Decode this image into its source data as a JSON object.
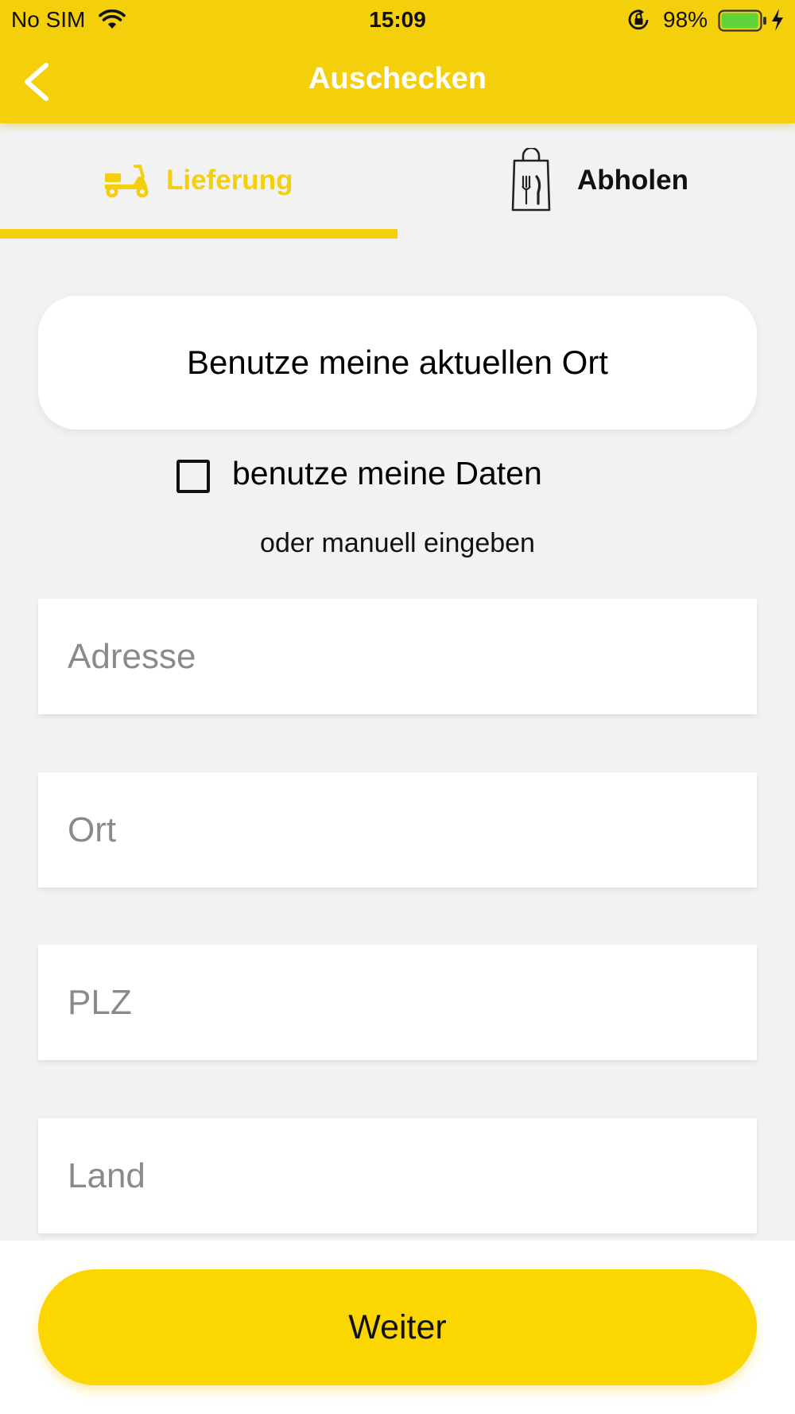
{
  "status_bar": {
    "carrier": "No SIM",
    "time": "15:09",
    "battery_percent": "98%",
    "battery_level": 0.98,
    "icons": [
      "wifi-icon",
      "orientation-lock-icon",
      "battery-icon",
      "charging-bolt-icon"
    ]
  },
  "nav": {
    "back_icon": "chevron-left-icon",
    "title": "Auschecken"
  },
  "tabs": [
    {
      "label": "Lieferung",
      "icon": "scooter-icon",
      "active": true
    },
    {
      "label": "Abholen",
      "icon": "shopping-bag-cutlery-icon",
      "active": false
    }
  ],
  "location_button": {
    "label": "Benutze meine aktuellen Ort"
  },
  "use_my_data": {
    "label": "benutze meine Daten",
    "checked": false
  },
  "manual_hint": "oder manuell eingeben",
  "fields": {
    "address": {
      "placeholder": "Adresse",
      "value": ""
    },
    "city": {
      "placeholder": "Ort",
      "value": ""
    },
    "zip": {
      "placeholder": "PLZ",
      "value": ""
    },
    "country": {
      "placeholder": "Land",
      "value": ""
    }
  },
  "next_button": {
    "label": "Weiter"
  },
  "colors": {
    "brand_yellow": "#f4cf0c",
    "button_yellow": "#fbd600",
    "background": "#f2f2f2"
  }
}
